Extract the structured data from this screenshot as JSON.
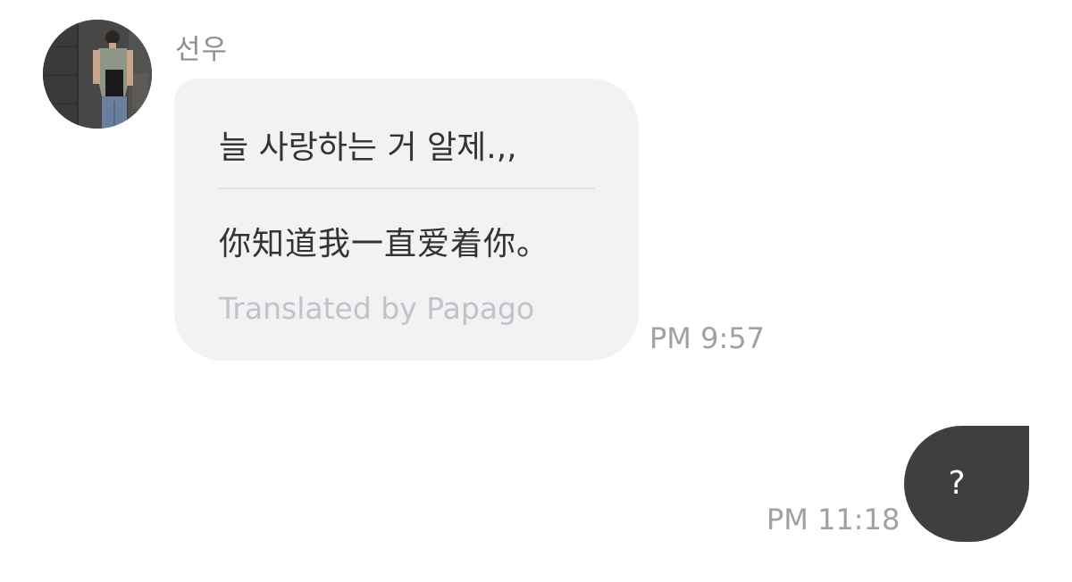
{
  "conversation": {
    "sender": {
      "name": "선우",
      "avatar": "profile-photo"
    },
    "messages": [
      {
        "direction": "incoming",
        "original_text": "늘 사랑하는 거 알제.,,",
        "translated_text": "你知道我一直爱着你。",
        "translation_credit": "Translated by Papago",
        "time": "PM 9:57"
      },
      {
        "direction": "outgoing",
        "text": "?",
        "time": "PM 11:18"
      }
    ]
  },
  "colors": {
    "incoming_bubble": "#f2f2f5",
    "outgoing_bubble": "#3f3f3f",
    "timestamp": "#a0a0a5",
    "sender_name": "#8e8e93"
  }
}
